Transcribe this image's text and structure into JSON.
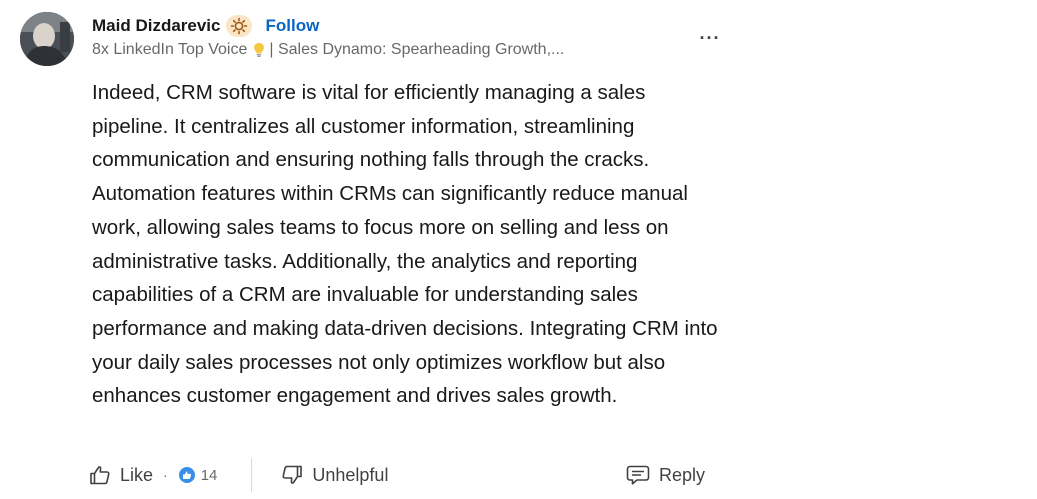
{
  "author": {
    "name": "Maid Dizdarevic",
    "badge_icon": "sun-badge-icon",
    "follow_label": "Follow",
    "headline_prefix": "8x LinkedIn Top Voice",
    "headline_suffix": "| Sales Dynamo: Spearheading Growth,..."
  },
  "menu": {
    "more_label": "···"
  },
  "comment": {
    "text": "Indeed, CRM software is vital for efficiently managing a sales pipeline. It centralizes all customer information, streamlining communication and ensuring nothing falls through the cracks. Automation features within CRMs can significantly reduce manual work, allowing sales teams to focus more on selling and less on administrative tasks. Additionally, the analytics and reporting capabilities of a CRM are invaluable for understanding sales performance and making data-driven decisions. Integrating CRM into your daily sales processes not only optimizes workflow but also enhances customer engagement and drives sales growth."
  },
  "actions": {
    "like_label": "Like",
    "separator": "·",
    "reaction_count": "14",
    "unhelpful_label": "Unhelpful",
    "reply_label": "Reply"
  },
  "colors": {
    "brand_blue": "#0a66c2",
    "text_primary": "rgba(0,0,0,0.9)",
    "text_secondary": "rgba(0,0,0,0.6)"
  }
}
